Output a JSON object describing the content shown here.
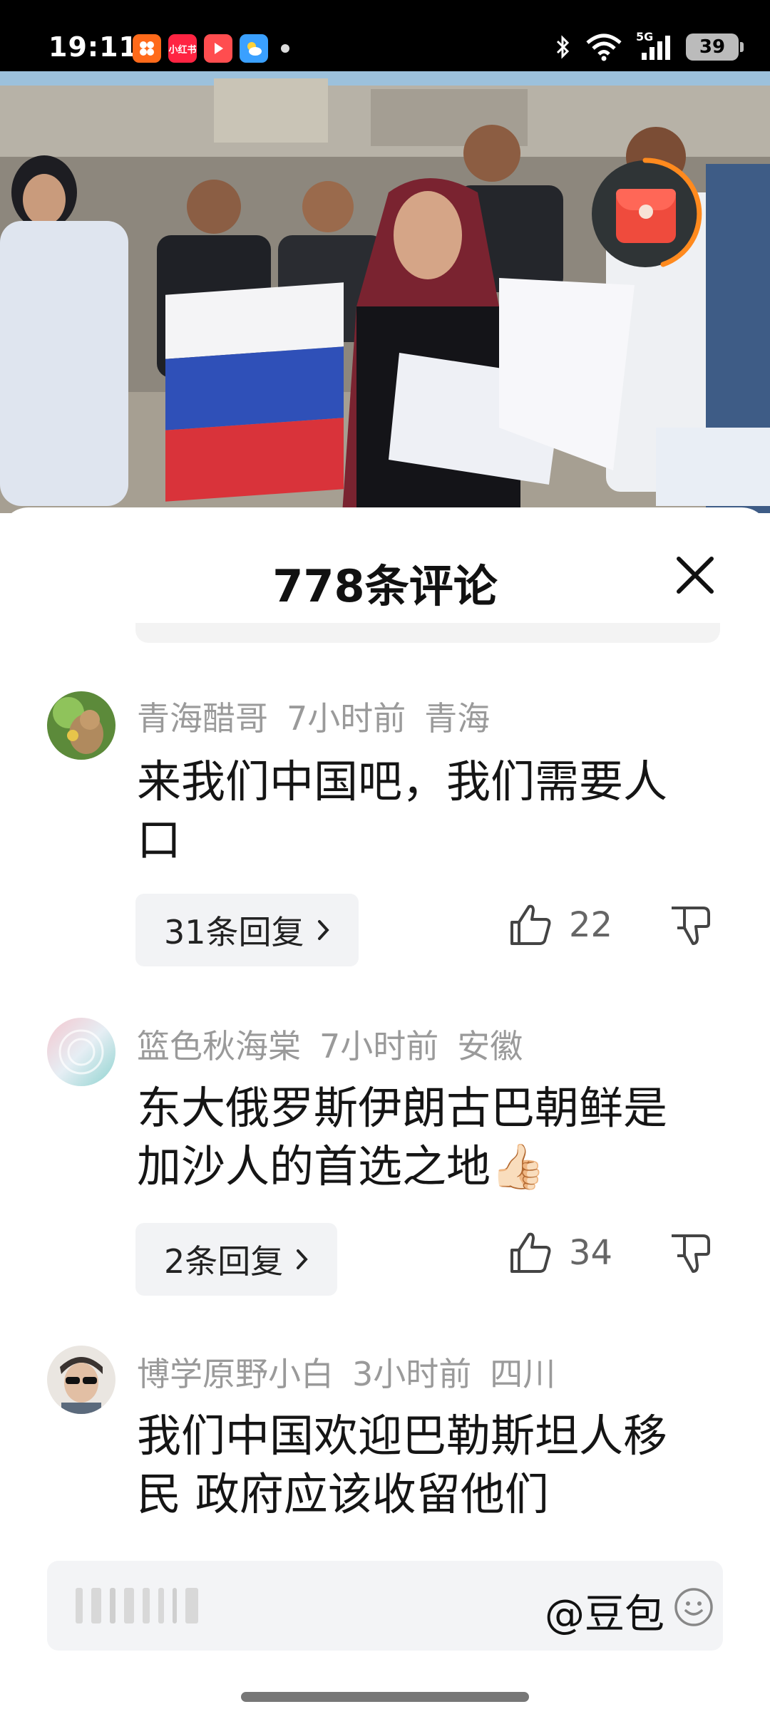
{
  "status_bar": {
    "time": "19:11",
    "apps": [
      {
        "icon": "xiaohongshu-like-icon",
        "label": "",
        "color": "#ff6a1a"
      },
      {
        "icon": "xiaohongshu-icon",
        "label": "小红书",
        "color": "#ff2442"
      },
      {
        "icon": "video-play-icon",
        "label": "",
        "color": "#ff4d4f"
      },
      {
        "icon": "weather-icon",
        "label": "",
        "color": "#3aa0ff"
      }
    ],
    "signal_label": "5G",
    "battery": "39"
  },
  "sheet": {
    "title": "778条评论"
  },
  "comments": [
    {
      "user": "青海醋哥",
      "time": "7小时前",
      "location": "青海",
      "text": "来我们中国吧，我们需要人口",
      "replies": "31条回复",
      "likes": "22"
    },
    {
      "user": "篮色秋海棠",
      "time": "7小时前",
      "location": "安徽",
      "text": "东大俄罗斯伊朗古巴朝鲜是加沙人的首选之地👍🏻",
      "replies": "2条回复",
      "likes": "34"
    },
    {
      "user": "博学原野小白",
      "time": "3小时前",
      "location": "四川",
      "text": "我们中国欢迎巴勒斯坦人移民 政府应该收留他们"
    }
  ],
  "input": {
    "mention": "@豆包"
  },
  "colors": {
    "accent_red": "#ef4b3d",
    "progress_orange": "#ff8a1e"
  }
}
